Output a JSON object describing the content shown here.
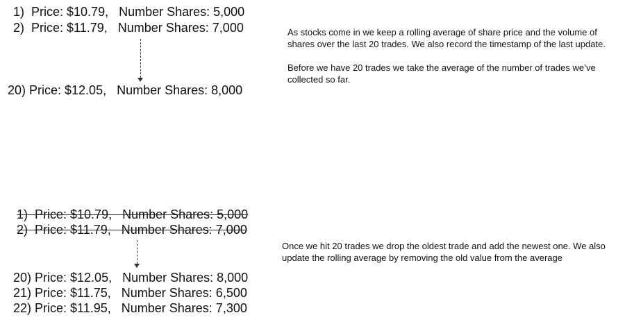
{
  "top_section": {
    "trades": [
      {
        "line": "1)  Price: $10.79,   Number Shares: 5,000"
      },
      {
        "line": "2)  Price: $11.79,   Number Shares: 7,000"
      },
      {
        "line": "20) Price: $12.05,   Number Shares: 8,000"
      }
    ],
    "note_paragraphs": [
      "As stocks come in we keep a rolling average of share price and the volume of shares over the last 20 trades.  We also record the timestamp of the last update.",
      "Before we have 20 trades we take the average of the number of trades we’ve collected so far."
    ]
  },
  "bottom_section": {
    "dropped_trades": [
      {
        "line": "1)  Price: $10.79,   Number Shares: 5,000"
      },
      {
        "line": "2)  Price: $11.79,   Number Shares: 7,000"
      }
    ],
    "trades": [
      {
        "line": "20) Price: $12.05,   Number Shares: 8,000"
      },
      {
        "line": "21) Price: $11.75,   Number Shares: 6,500"
      },
      {
        "line": "22) Price: $11.95,   Number Shares: 7,300"
      }
    ],
    "note_paragraphs": [
      "Once we hit 20 trades we drop the oldest trade and add the newest one.  We also update the rolling average by removing the old value from the average"
    ]
  }
}
